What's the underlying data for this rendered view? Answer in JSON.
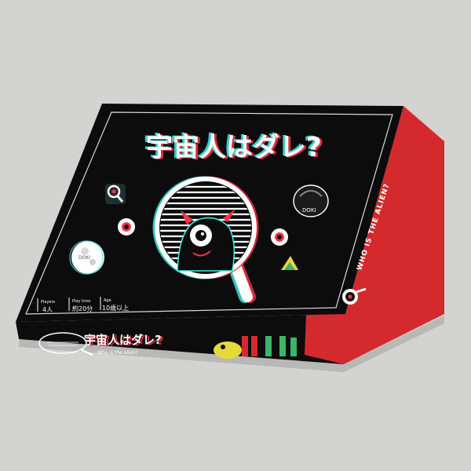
{
  "colors": {
    "background": "#d3d3d2",
    "box_black": "#0c0c0d",
    "box_red": "#d42a2e",
    "glitch_red": "#ff3347",
    "glitch_cyan": "#3ff0e6",
    "white": "#ffffff"
  },
  "box": {
    "title": "宇宙人はダレ?",
    "side_title": "WHO IS THE ALIEN?",
    "front_title": "宇宙人はダレ?",
    "front_subtitle": "Who is the alien?",
    "badge_left": "DOKI",
    "badge_right": "DOKI",
    "specs": [
      {
        "label": "Players",
        "value": "4人"
      },
      {
        "label": "Play time",
        "value": "約20分"
      },
      {
        "label": "Age",
        "value": "10歳以上"
      }
    ]
  },
  "icons": [
    "magnifier-alien-icon",
    "planet-icon",
    "eye-icon",
    "ufo-icon",
    "pawn-icon"
  ]
}
